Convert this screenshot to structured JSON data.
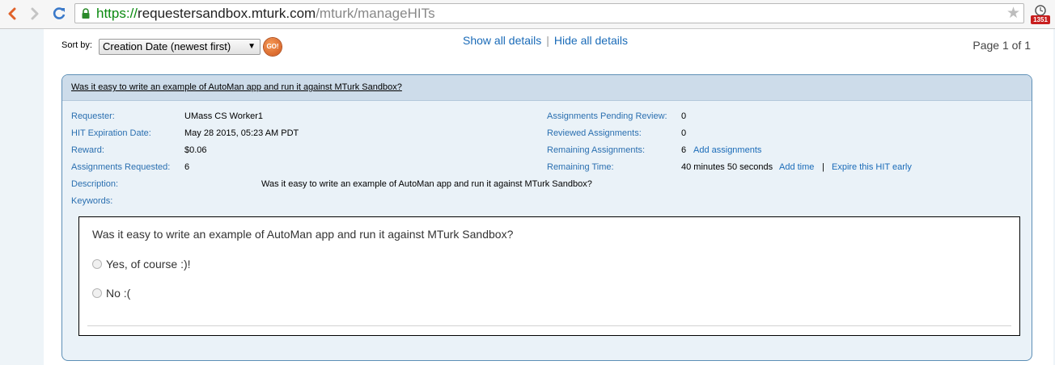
{
  "browser": {
    "url_protocol": "https://",
    "url_host": "requestersandbox.mturk.com",
    "url_path": "/mturk/manageHITs",
    "extension_badge": "1351"
  },
  "toolbar": {
    "sort_label": "Sort by:",
    "sort_value": "Creation Date (newest first)",
    "go_label": "GO!",
    "show_all": "Show all details",
    "separator": "|",
    "hide_all": "Hide all details",
    "page_info": "Page 1 of 1"
  },
  "hit": {
    "title": "Was it easy to write an example of AutoMan app and run it against MTurk Sandbox?",
    "requester_label": "Requester:",
    "requester": "UMass CS Worker1",
    "expiration_label": "HIT Expiration Date:",
    "expiration": "May 28 2015, 05:23 AM PDT",
    "reward_label": "Reward:",
    "reward": "$0.06",
    "requested_label": "Assignments Requested:",
    "requested": "6",
    "description_label": "Description:",
    "description": "Was it easy to write an example of AutoMan app and run it against MTurk Sandbox?",
    "keywords_label": "Keywords:",
    "pending_label": "Assignments Pending Review:",
    "pending": "0",
    "reviewed_label": "Reviewed Assignments:",
    "reviewed": "0",
    "remaining_label": "Remaining Assignments:",
    "remaining": "6",
    "add_assignments": "Add assignments",
    "time_label": "Remaining Time:",
    "time": "40 minutes 50 seconds",
    "add_time": "Add time",
    "time_sep": "|",
    "expire_early": "Expire this HIT early"
  },
  "preview": {
    "question": "Was it easy to write an example of AutoMan app and run it against MTurk Sandbox?",
    "options": [
      "Yes, of course :)!",
      "No :("
    ]
  },
  "colors": {
    "link": "#1a6bb8",
    "label": "#2a6fb0",
    "header_bg": "#cddcea",
    "box_border": "#5d8fb6",
    "go_button": "#d0561c"
  }
}
